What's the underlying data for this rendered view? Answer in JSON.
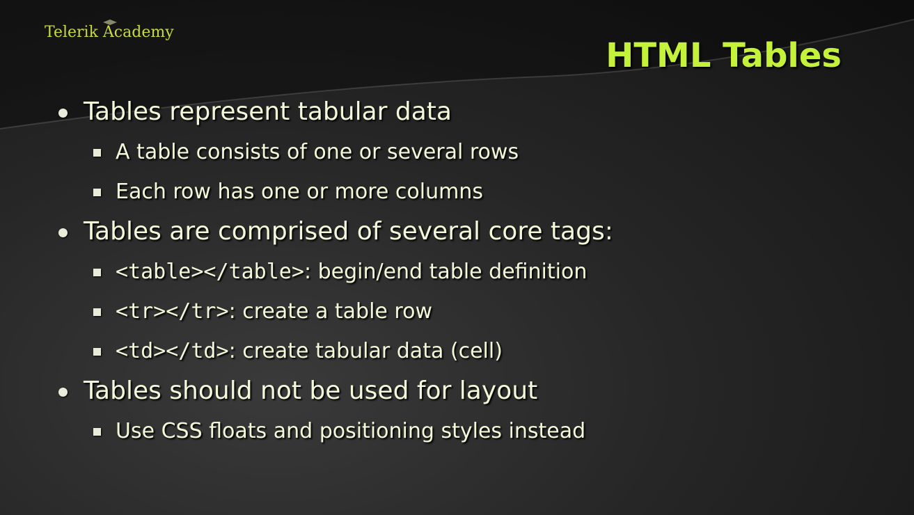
{
  "logo": {
    "text": "Telerik Academy"
  },
  "title": "HTML Tables",
  "bullets": [
    {
      "level": 1,
      "text": "Tables represent tabular data"
    },
    {
      "level": 2,
      "text": "A table consists of one or several rows"
    },
    {
      "level": 2,
      "text": "Each row has one or more columns"
    },
    {
      "level": 1,
      "text": "Tables are comprised of several core tags:"
    },
    {
      "level": 2,
      "code": "<table></table>",
      "text": ": begin/end table definition"
    },
    {
      "level": 2,
      "code": "<tr></tr>",
      "text": ": create a table row"
    },
    {
      "level": 2,
      "code": "<td></td>",
      "text": ": create tabular data (cell)"
    },
    {
      "level": 1,
      "text": "Tables should not be used for layout"
    },
    {
      "level": 2,
      "text": "Use CSS floats and positioning styles instead"
    }
  ],
  "colors": {
    "title": "#c4f23a",
    "logo": "#c8dc3c",
    "text": "#f2f8d8",
    "background": "#1e1e1e"
  }
}
